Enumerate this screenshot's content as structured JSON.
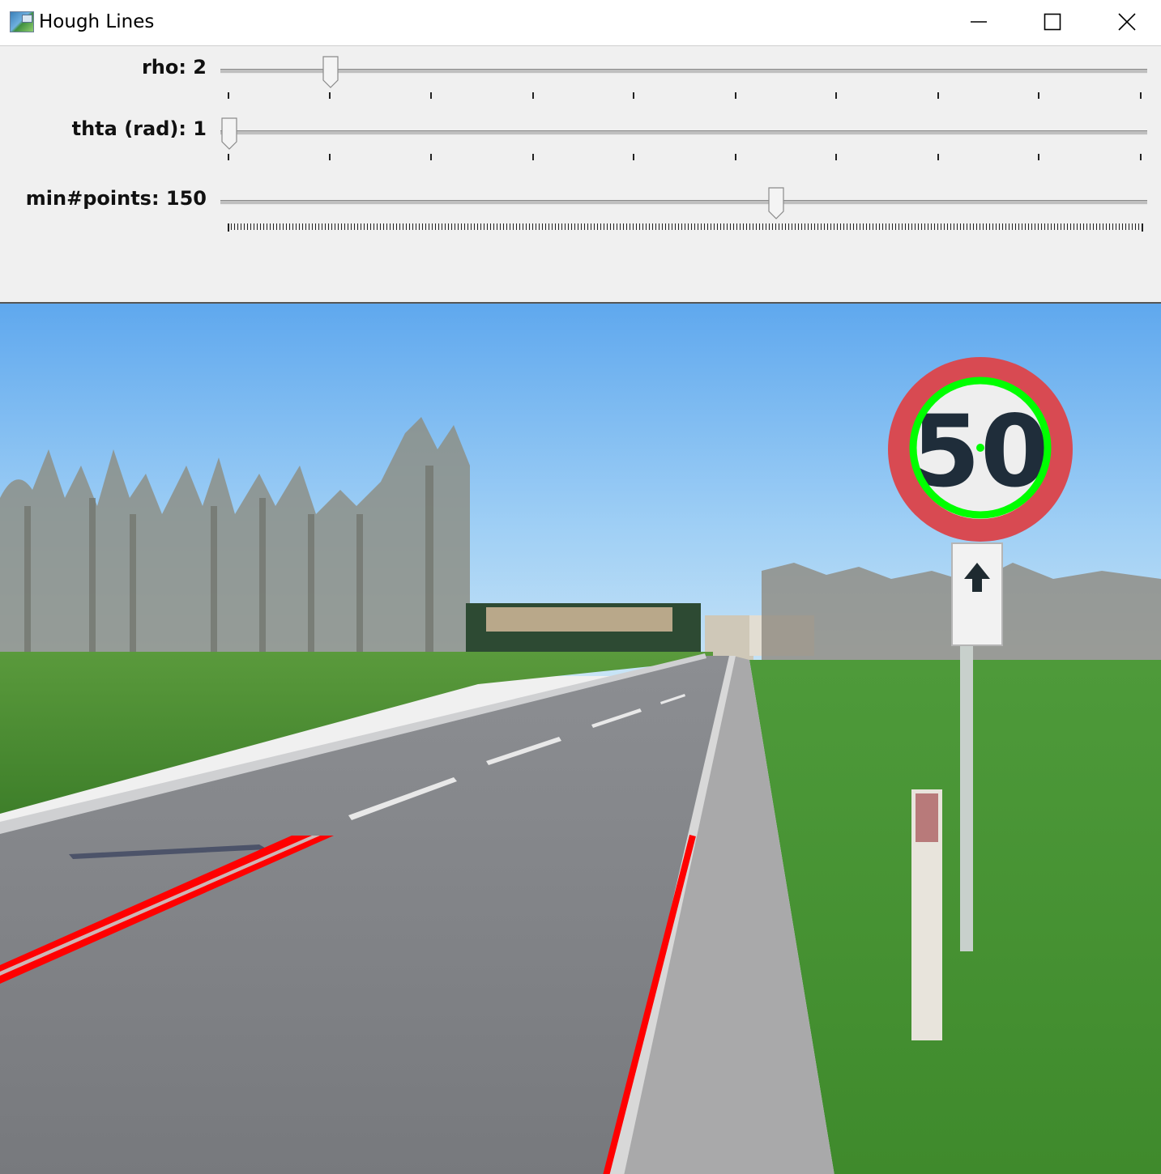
{
  "window": {
    "title": "Hough Lines",
    "controls": [
      "minimize-icon",
      "maximize-icon",
      "close-icon"
    ]
  },
  "trackbars": [
    {
      "label": "rho: 2",
      "value": 2,
      "max": 20,
      "position_fraction": 0.11
    },
    {
      "label": "thta (rad): 1",
      "value": 1,
      "max": 90,
      "position_fraction": 0.0
    },
    {
      "label": "min#points: 150",
      "value": 150,
      "max": 250,
      "position_fraction": 0.6
    }
  ],
  "image": {
    "description_icon": "road-scene-with-speed-sign",
    "sign_text": "50",
    "overlay_colors": {
      "detected_lines": "#ff0000",
      "detected_circle": "#00ff00"
    }
  },
  "colors": {
    "panel_bg": "#f0f0f0",
    "titlebar_bg": "#ffffff"
  }
}
